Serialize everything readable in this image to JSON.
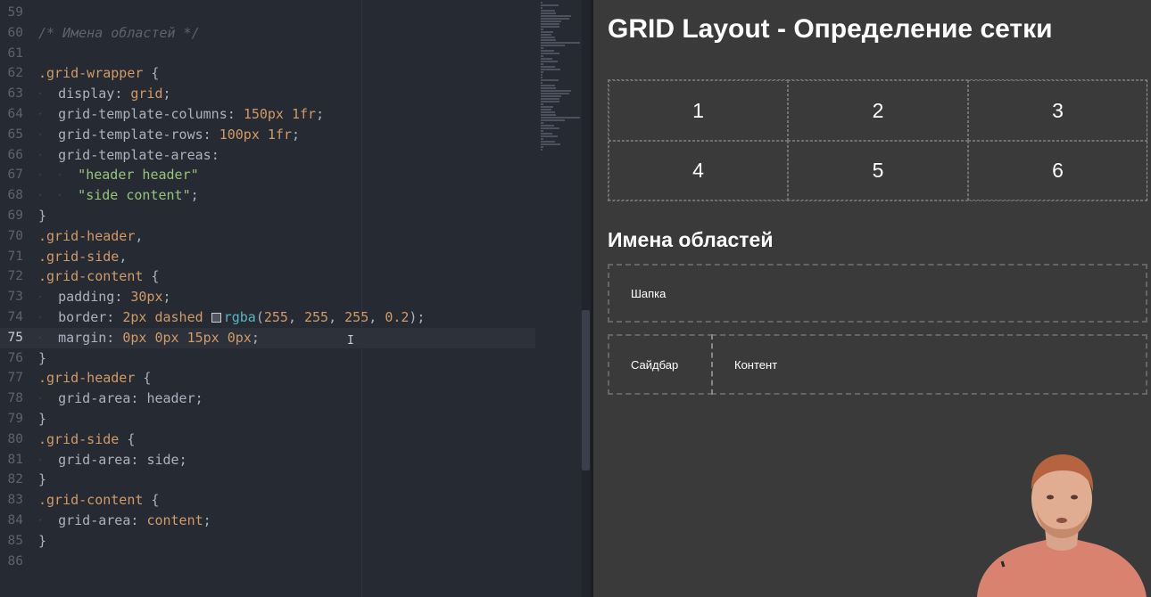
{
  "editor": {
    "current_line": 75,
    "lines": [
      {
        "n": 59,
        "tokens": []
      },
      {
        "n": 60,
        "tokens": [
          {
            "c": "t-comment",
            "t": "/* Имена областей */"
          }
        ]
      },
      {
        "n": 61,
        "tokens": []
      },
      {
        "n": 62,
        "tokens": [
          {
            "c": "t-sel",
            "t": ".grid-wrapper"
          },
          {
            "c": "t-punc",
            "t": " {"
          }
        ]
      },
      {
        "n": 63,
        "tokens": [
          {
            "c": "t-guide",
            "t": "⸱  "
          },
          {
            "c": "t-prop",
            "t": "display"
          },
          {
            "c": "t-punc",
            "t": ": "
          },
          {
            "c": "t-val",
            "t": "grid"
          },
          {
            "c": "t-punc",
            "t": ";"
          }
        ]
      },
      {
        "n": 64,
        "tokens": [
          {
            "c": "t-guide",
            "t": "⸱  "
          },
          {
            "c": "t-prop",
            "t": "grid-template-columns"
          },
          {
            "c": "t-punc",
            "t": ": "
          },
          {
            "c": "t-val",
            "t": "150px 1fr"
          },
          {
            "c": "t-punc",
            "t": ";"
          }
        ]
      },
      {
        "n": 65,
        "tokens": [
          {
            "c": "t-guide",
            "t": "⸱  "
          },
          {
            "c": "t-prop",
            "t": "grid-template-rows"
          },
          {
            "c": "t-punc",
            "t": ": "
          },
          {
            "c": "t-val",
            "t": "100px 1fr"
          },
          {
            "c": "t-punc",
            "t": ";"
          }
        ]
      },
      {
        "n": 66,
        "tokens": [
          {
            "c": "t-guide",
            "t": "⸱  "
          },
          {
            "c": "t-prop",
            "t": "grid-template-areas"
          },
          {
            "c": "t-punc",
            "t": ":"
          }
        ]
      },
      {
        "n": 67,
        "tokens": [
          {
            "c": "t-guide",
            "t": "⸱  ⸱  "
          },
          {
            "c": "t-str",
            "t": "\"header header\""
          }
        ]
      },
      {
        "n": 68,
        "tokens": [
          {
            "c": "t-guide",
            "t": "⸱  ⸱  "
          },
          {
            "c": "t-str",
            "t": "\"side content\""
          },
          {
            "c": "t-punc",
            "t": ";"
          }
        ]
      },
      {
        "n": 69,
        "tokens": [
          {
            "c": "t-punc",
            "t": "}"
          }
        ]
      },
      {
        "n": 70,
        "tokens": [
          {
            "c": "t-sel",
            "t": ".grid-header"
          },
          {
            "c": "t-punc",
            "t": ","
          }
        ]
      },
      {
        "n": 71,
        "tokens": [
          {
            "c": "t-sel",
            "t": ".grid-side"
          },
          {
            "c": "t-punc",
            "t": ","
          }
        ]
      },
      {
        "n": 72,
        "tokens": [
          {
            "c": "t-sel",
            "t": ".grid-content"
          },
          {
            "c": "t-punc",
            "t": " {"
          }
        ]
      },
      {
        "n": 73,
        "tokens": [
          {
            "c": "t-guide",
            "t": "⸱  "
          },
          {
            "c": "t-prop",
            "t": "padding"
          },
          {
            "c": "t-punc",
            "t": ": "
          },
          {
            "c": "t-val",
            "t": "30px"
          },
          {
            "c": "t-punc",
            "t": ";"
          }
        ]
      },
      {
        "n": 74,
        "tokens": [
          {
            "c": "t-guide",
            "t": "⸱  "
          },
          {
            "c": "t-prop",
            "t": "border"
          },
          {
            "c": "t-punc",
            "t": ": "
          },
          {
            "c": "t-val",
            "t": "2px dashed "
          },
          {
            "c": "swatch",
            "t": ""
          },
          {
            "c": "t-fn",
            "t": "rgba"
          },
          {
            "c": "t-punc",
            "t": "("
          },
          {
            "c": "t-val",
            "t": "255"
          },
          {
            "c": "t-punc",
            "t": ", "
          },
          {
            "c": "t-val",
            "t": "255"
          },
          {
            "c": "t-punc",
            "t": ", "
          },
          {
            "c": "t-val",
            "t": "255"
          },
          {
            "c": "t-punc",
            "t": ", "
          },
          {
            "c": "t-val",
            "t": "0.2"
          },
          {
            "c": "t-punc",
            "t": ");"
          }
        ]
      },
      {
        "n": 75,
        "tokens": [
          {
            "c": "t-guide",
            "t": "⸱  "
          },
          {
            "c": "t-prop",
            "t": "margin"
          },
          {
            "c": "t-punc",
            "t": ": "
          },
          {
            "c": "t-val",
            "t": "0px 0px 15px 0px"
          },
          {
            "c": "t-punc",
            "t": ";"
          }
        ]
      },
      {
        "n": 76,
        "tokens": [
          {
            "c": "t-punc",
            "t": "}"
          }
        ]
      },
      {
        "n": 77,
        "tokens": [
          {
            "c": "t-sel",
            "t": ".grid-header"
          },
          {
            "c": "t-punc",
            "t": " {"
          }
        ]
      },
      {
        "n": 78,
        "tokens": [
          {
            "c": "t-guide",
            "t": "⸱  "
          },
          {
            "c": "t-prop",
            "t": "grid-area"
          },
          {
            "c": "t-punc",
            "t": ": "
          },
          {
            "c": "t-plain",
            "t": "header"
          },
          {
            "c": "t-punc",
            "t": ";"
          }
        ]
      },
      {
        "n": 79,
        "tokens": [
          {
            "c": "t-punc",
            "t": "}"
          }
        ]
      },
      {
        "n": 80,
        "tokens": [
          {
            "c": "t-sel",
            "t": ".grid-side"
          },
          {
            "c": "t-punc",
            "t": " {"
          }
        ]
      },
      {
        "n": 81,
        "tokens": [
          {
            "c": "t-guide",
            "t": "⸱  "
          },
          {
            "c": "t-prop",
            "t": "grid-area"
          },
          {
            "c": "t-punc",
            "t": ": "
          },
          {
            "c": "t-plain",
            "t": "side"
          },
          {
            "c": "t-punc",
            "t": ";"
          }
        ]
      },
      {
        "n": 82,
        "tokens": [
          {
            "c": "t-punc",
            "t": "}"
          }
        ]
      },
      {
        "n": 83,
        "tokens": [
          {
            "c": "t-sel",
            "t": ".grid-content"
          },
          {
            "c": "t-punc",
            "t": " {"
          }
        ]
      },
      {
        "n": 84,
        "tokens": [
          {
            "c": "t-guide",
            "t": "⸱  "
          },
          {
            "c": "t-prop",
            "t": "grid-area"
          },
          {
            "c": "t-punc",
            "t": ": "
          },
          {
            "c": "t-val",
            "t": "content"
          },
          {
            "c": "t-punc",
            "t": ";"
          }
        ]
      },
      {
        "n": 85,
        "tokens": [
          {
            "c": "t-punc",
            "t": "}"
          }
        ]
      },
      {
        "n": 86,
        "tokens": []
      }
    ]
  },
  "preview": {
    "title": "GRID Layout - Определение сетки",
    "cells": [
      "1",
      "2",
      "3",
      "4",
      "5",
      "6"
    ],
    "areas_title": "Имена областей",
    "area_header": "Шапка",
    "area_side": "Сайдбар",
    "area_content": "Контент"
  },
  "colors": {
    "editor_bg": "#262b33",
    "preview_bg": "#3a3a3a",
    "selector": "#d19a66",
    "string": "#98c379",
    "function": "#56b6c2",
    "comment": "#5c6370"
  }
}
